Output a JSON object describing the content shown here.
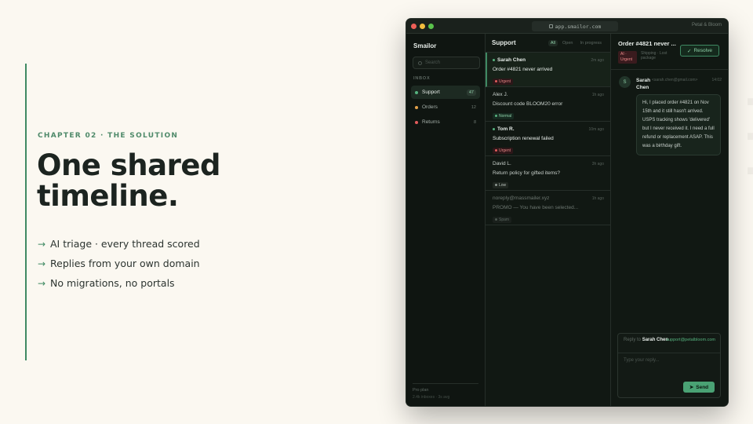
{
  "slide": {
    "chapter": "CHAPTER 02 · THE SOLUTION",
    "headline_line1": "One shared",
    "headline_line2": "timeline.",
    "bullets": [
      "AI triage · every thread scored",
      "Replies from your own domain",
      "No migrations, no portals"
    ],
    "accent_color": "#3f8a63"
  },
  "window": {
    "url": "app.smailor.com",
    "brand": "Petal & Bloom"
  },
  "sidebar": {
    "logo": "Smailor",
    "search_placeholder": "Search",
    "section_label": "INBOX",
    "items": [
      {
        "label": "Support",
        "count": "47",
        "dot_color": "#56b37f"
      },
      {
        "label": "Orders",
        "count": "12",
        "dot_color": "#e3a14a"
      },
      {
        "label": "Returns",
        "count": "8",
        "dot_color": "#e25c5c"
      }
    ],
    "plan_line1": "Pro plan",
    "plan_line2": "2.4k inboxes · 3s avg"
  },
  "list": {
    "title": "Support",
    "filters": [
      "All",
      "Open",
      "In progress"
    ],
    "threads": [
      {
        "sender": "Sarah Chen",
        "time": "2m ago",
        "subject": "Order #4821 never arrived",
        "tag": "Urgent"
      },
      {
        "sender": "Alex J.",
        "time": "1h ago",
        "subject": "Discount code BLOOM20 error",
        "tag": "Normal"
      },
      {
        "sender": "Tom R.",
        "time": "10m ago",
        "subject": "Subscription renewal failed",
        "tag": "Urgent"
      },
      {
        "sender": "David L.",
        "time": "3h ago",
        "subject": "Return policy for gifted items?",
        "tag": "Low"
      },
      {
        "sender": "noreply@massmailer.xyz",
        "time": "1h ago",
        "subject": "PROMO — You have been selected...",
        "tag": "Spam"
      }
    ]
  },
  "conversation": {
    "title": "Order #4821 never ...",
    "ai_tag": "AI · Urgent",
    "subline": "Shipping · Lost package",
    "resolve_label": "Resolve",
    "message": {
      "avatar": "S",
      "from": "Sarah Chen",
      "email": "<sarah.chen@gmail.com>",
      "time": "14:02",
      "body": "Hi, I placed order #4821 on Nov 15th and it still hasn't arrived. USPS tracking shows 'delivered' but I never received it. I need a full refund or replacement ASAP. This was a birthday gift."
    },
    "composer": {
      "reply_to_prefix": "Reply to",
      "reply_to_name": "Sarah Chen",
      "from_address": "support@petalbloom.com",
      "placeholder": "Type your reply...",
      "send_label": "Send"
    }
  }
}
